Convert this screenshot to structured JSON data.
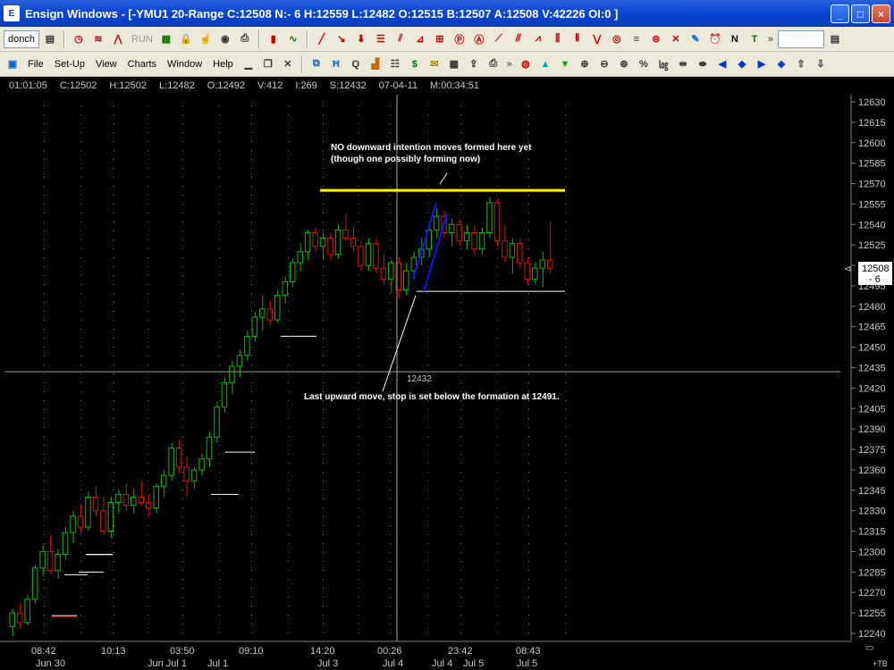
{
  "window": {
    "app_name": "Ensign Windows",
    "title": "Ensign Windows - [-YMU1 20-Range C:12508 N:- 6 H:12559 L:12482 O:12515 B:12507 A:12508 V:42226 OI:0 ]",
    "controls": [
      "_",
      "□",
      "×"
    ]
  },
  "toolbar1": {
    "chart_combo": "donch",
    "run_label": "RUN",
    "more_label": "»"
  },
  "toolbar2": {
    "menus": [
      "File",
      "Set-Up",
      "View",
      "Charts",
      "Window",
      "Help"
    ],
    "more_label": "»"
  },
  "infobar": {
    "time": "01:01:05",
    "close": "C:12502",
    "high": "H:12502",
    "low": "L:12482",
    "open": "O:12492",
    "volume": "V:412",
    "index": "I:269",
    "stop": "S:12432",
    "date": "07-04-11",
    "m": "M:00:34:51"
  },
  "annotations": {
    "top_note_line1": "NO downward intention moves formed here yet",
    "top_note_line2": "(though one possibly forming now)",
    "bottom_note": "Last upward move, stop is set below the formation at 12491.",
    "crosshair_value": "12432"
  },
  "price_marker": {
    "value": "12508",
    "change": "- 6"
  },
  "footer_tag": "+TB",
  "colors": {
    "up_candle": "#00c000",
    "down_candle": "#e01010",
    "resistance": "#ffff00",
    "intention_line": "#1010ff",
    "support": "#ffffff"
  },
  "chart_data": {
    "type": "candlestick",
    "symbol": "YMU1 20-Range",
    "ylim": [
      12240,
      12630
    ],
    "y_ticks": [
      12630,
      12615,
      12600,
      12585,
      12570,
      12555,
      12540,
      12525,
      12510,
      12495,
      12480,
      12465,
      12450,
      12435,
      12420,
      12405,
      12390,
      12375,
      12360,
      12345,
      12330,
      12315,
      12300,
      12285,
      12270,
      12255,
      12240
    ],
    "x_time_labels": [
      "08:42",
      "10:13",
      "03:50",
      "09:10",
      "14:20",
      "00:26",
      "23:42",
      "08:43"
    ],
    "x_date_labels": [
      "Jun 30",
      "Jun Jul 1",
      "Jul 1",
      "Jul 3",
      "Jul 4",
      "Jul 4",
      "Jul 5",
      "Jul 5"
    ],
    "resistance_level": 12565,
    "support_level": 12491,
    "crosshair_level": 12432,
    "candles": [
      [
        12245,
        12258,
        12238,
        12255
      ],
      [
        12255,
        12262,
        12244,
        12248
      ],
      [
        12248,
        12268,
        12246,
        12265
      ],
      [
        12265,
        12290,
        12262,
        12288
      ],
      [
        12288,
        12305,
        12282,
        12300
      ],
      [
        12300,
        12312,
        12284,
        12286
      ],
      [
        12286,
        12302,
        12280,
        12298
      ],
      [
        12298,
        12318,
        12294,
        12314
      ],
      [
        12314,
        12330,
        12306,
        12326
      ],
      [
        12326,
        12335,
        12314,
        12318
      ],
      [
        12318,
        12344,
        12315,
        12340
      ],
      [
        12340,
        12348,
        12326,
        12330
      ],
      [
        12330,
        12340,
        12312,
        12315
      ],
      [
        12315,
        12340,
        12310,
        12336
      ],
      [
        12336,
        12346,
        12328,
        12342
      ],
      [
        12342,
        12350,
        12330,
        12334
      ],
      [
        12334,
        12346,
        12328,
        12340
      ],
      [
        12340,
        12352,
        12334,
        12336
      ],
      [
        12336,
        12342,
        12326,
        12332
      ],
      [
        12332,
        12350,
        12328,
        12348
      ],
      [
        12348,
        12360,
        12340,
        12356
      ],
      [
        12356,
        12380,
        12352,
        12376
      ],
      [
        12376,
        12382,
        12358,
        12362
      ],
      [
        12362,
        12370,
        12340,
        12352
      ],
      [
        12352,
        12362,
        12346,
        12360
      ],
      [
        12360,
        12372,
        12356,
        12368
      ],
      [
        12368,
        12388,
        12362,
        12384
      ],
      [
        12384,
        12410,
        12380,
        12406
      ],
      [
        12406,
        12428,
        12402,
        12424
      ],
      [
        12424,
        12440,
        12416,
        12436
      ],
      [
        12436,
        12448,
        12428,
        12444
      ],
      [
        12444,
        12462,
        12440,
        12458
      ],
      [
        12458,
        12476,
        12454,
        12472
      ],
      [
        12472,
        12488,
        12462,
        12478
      ],
      [
        12478,
        12484,
        12466,
        12470
      ],
      [
        12470,
        12492,
        12468,
        12488
      ],
      [
        12488,
        12502,
        12482,
        12498
      ],
      [
        12498,
        12515,
        12494,
        12512
      ],
      [
        12512,
        12526,
        12506,
        12520
      ],
      [
        12520,
        12536,
        12514,
        12534
      ],
      [
        12534,
        12538,
        12520,
        12524
      ],
      [
        12524,
        12534,
        12514,
        12530
      ],
      [
        12530,
        12534,
        12514,
        12518
      ],
      [
        12518,
        12540,
        12515,
        12536
      ],
      [
        12536,
        12548,
        12528,
        12530
      ],
      [
        12530,
        12538,
        12520,
        12524
      ],
      [
        12524,
        12528,
        12506,
        12510
      ],
      [
        12510,
        12530,
        12506,
        12526
      ],
      [
        12526,
        12530,
        12504,
        12508
      ],
      [
        12508,
        12518,
        12496,
        12500
      ],
      [
        12500,
        12514,
        12490,
        12512
      ],
      [
        12512,
        12516,
        12486,
        12492
      ],
      [
        12492,
        12512,
        12488,
        12506
      ],
      [
        12506,
        12520,
        12500,
        12516
      ],
      [
        12516,
        12530,
        12510,
        12522
      ],
      [
        12522,
        12540,
        12516,
        12536
      ],
      [
        12536,
        12552,
        12530,
        12546
      ],
      [
        12546,
        12550,
        12530,
        12534
      ],
      [
        12534,
        12544,
        12524,
        12540
      ],
      [
        12540,
        12544,
        12524,
        12528
      ],
      [
        12528,
        12540,
        12522,
        12534
      ],
      [
        12534,
        12540,
        12518,
        12522
      ],
      [
        12522,
        12538,
        12518,
        12534
      ],
      [
        12534,
        12560,
        12530,
        12556
      ],
      [
        12556,
        12559,
        12524,
        12528
      ],
      [
        12528,
        12540,
        12512,
        12516
      ],
      [
        12516,
        12530,
        12504,
        12526
      ],
      [
        12526,
        12530,
        12508,
        12512
      ],
      [
        12512,
        12516,
        12496,
        12500
      ],
      [
        12500,
        12512,
        12496,
        12508
      ],
      [
        12508,
        12520,
        12494,
        12514
      ],
      [
        12514,
        12542,
        12504,
        12508
      ]
    ]
  }
}
